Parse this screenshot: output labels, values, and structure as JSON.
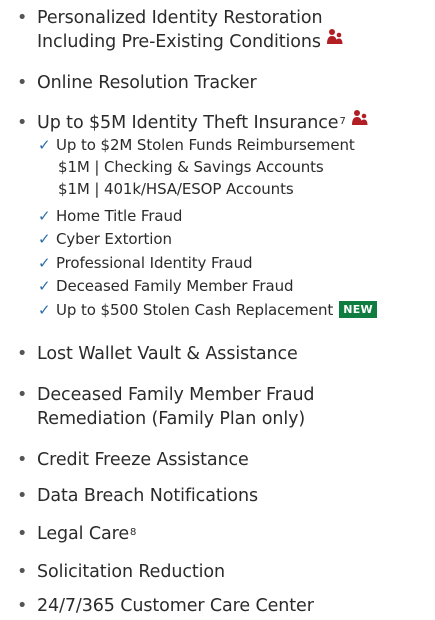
{
  "features": {
    "item1_line1": "Personalized Identity Restoration",
    "item1_line2": "Including Pre-Existing Conditions",
    "item2": "Online Resolution Tracker",
    "item3": "Up to $5M Identity Theft Insurance",
    "item3_sup": "7",
    "sub": [
      "Up to $2M Stolen Funds Reimbursement",
      "$1M | Checking & Savings Accounts",
      "$1M | 401k/HSA/ESOP Accounts",
      "Home Title Fraud",
      "Cyber Extortion",
      "Professional Identity Fraud",
      "Deceased Family Member Fraud",
      "Up to $500 Stolen Cash Replacement"
    ],
    "new_badge": "NEW",
    "item4": "Lost Wallet Vault & Assistance",
    "item5_line1": "Deceased Family Member Fraud",
    "item5_line2": "Remediation (Family Plan only)",
    "item6": "Credit Freeze Assistance",
    "item7": "Data Breach Notifications",
    "item8": "Legal Care",
    "item8_sup": "8",
    "item9": "Solicitation Reduction",
    "item10": "24/7/365 Customer Care Center"
  },
  "colors": {
    "icon": "#b11f24",
    "check": "#2d6ea8",
    "badge": "#0e7d3f"
  },
  "icons": {
    "family": "family-icon",
    "check": "check-icon",
    "bullet": "bullet-icon"
  }
}
